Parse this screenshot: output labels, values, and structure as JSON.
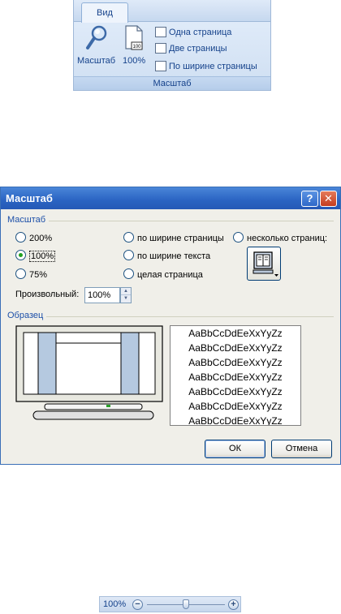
{
  "ribbon": {
    "tab_label": "Вид",
    "zoom_button_label": "Масштаб",
    "percent_button_label": "100%",
    "one_page_label": "Одна страница",
    "two_pages_label": "Две страницы",
    "page_width_label": "По ширине страницы",
    "group_label": "Масштаб"
  },
  "dialog": {
    "title": "Масштаб",
    "help_symbol": "?",
    "close_symbol": "✕",
    "zoom_group_label": "Масштаб",
    "options": {
      "z200": "200%",
      "z100": "100%",
      "z75": "75%",
      "page_width": "по ширине страницы",
      "text_width": "по ширине текста",
      "whole_page": "целая страница",
      "many_pages": "несколько страниц:"
    },
    "selected_option": "100%",
    "custom_label": "Произвольный:",
    "custom_value": "100%",
    "sample_group_label": "Образец",
    "sample_text": "AaBbCcDdEeXxYyZz",
    "sample_lines": [
      "AaBbCcDdEeXxYyZz",
      "AaBbCcDdEeXxYyZz",
      "AaBbCcDdEeXxYyZz",
      "AaBbCcDdEeXxYyZz",
      "AaBbCcDdEeXxYyZz",
      "AaBbCcDdEeXxYyZz",
      "AaBbCcDdEeXxYyZz"
    ],
    "ok_label": "ОК",
    "cancel_label": "Отмена"
  },
  "statusbar_zoom": {
    "percent": "100%",
    "minus_symbol": "−",
    "plus_symbol": "+",
    "level_fraction": 0.5
  },
  "colors": {
    "titlebar": "#2a63c2",
    "ribbon_text": "#15428b",
    "group_label_text": "#1c4fa8",
    "selected_radio": "#21a121"
  }
}
